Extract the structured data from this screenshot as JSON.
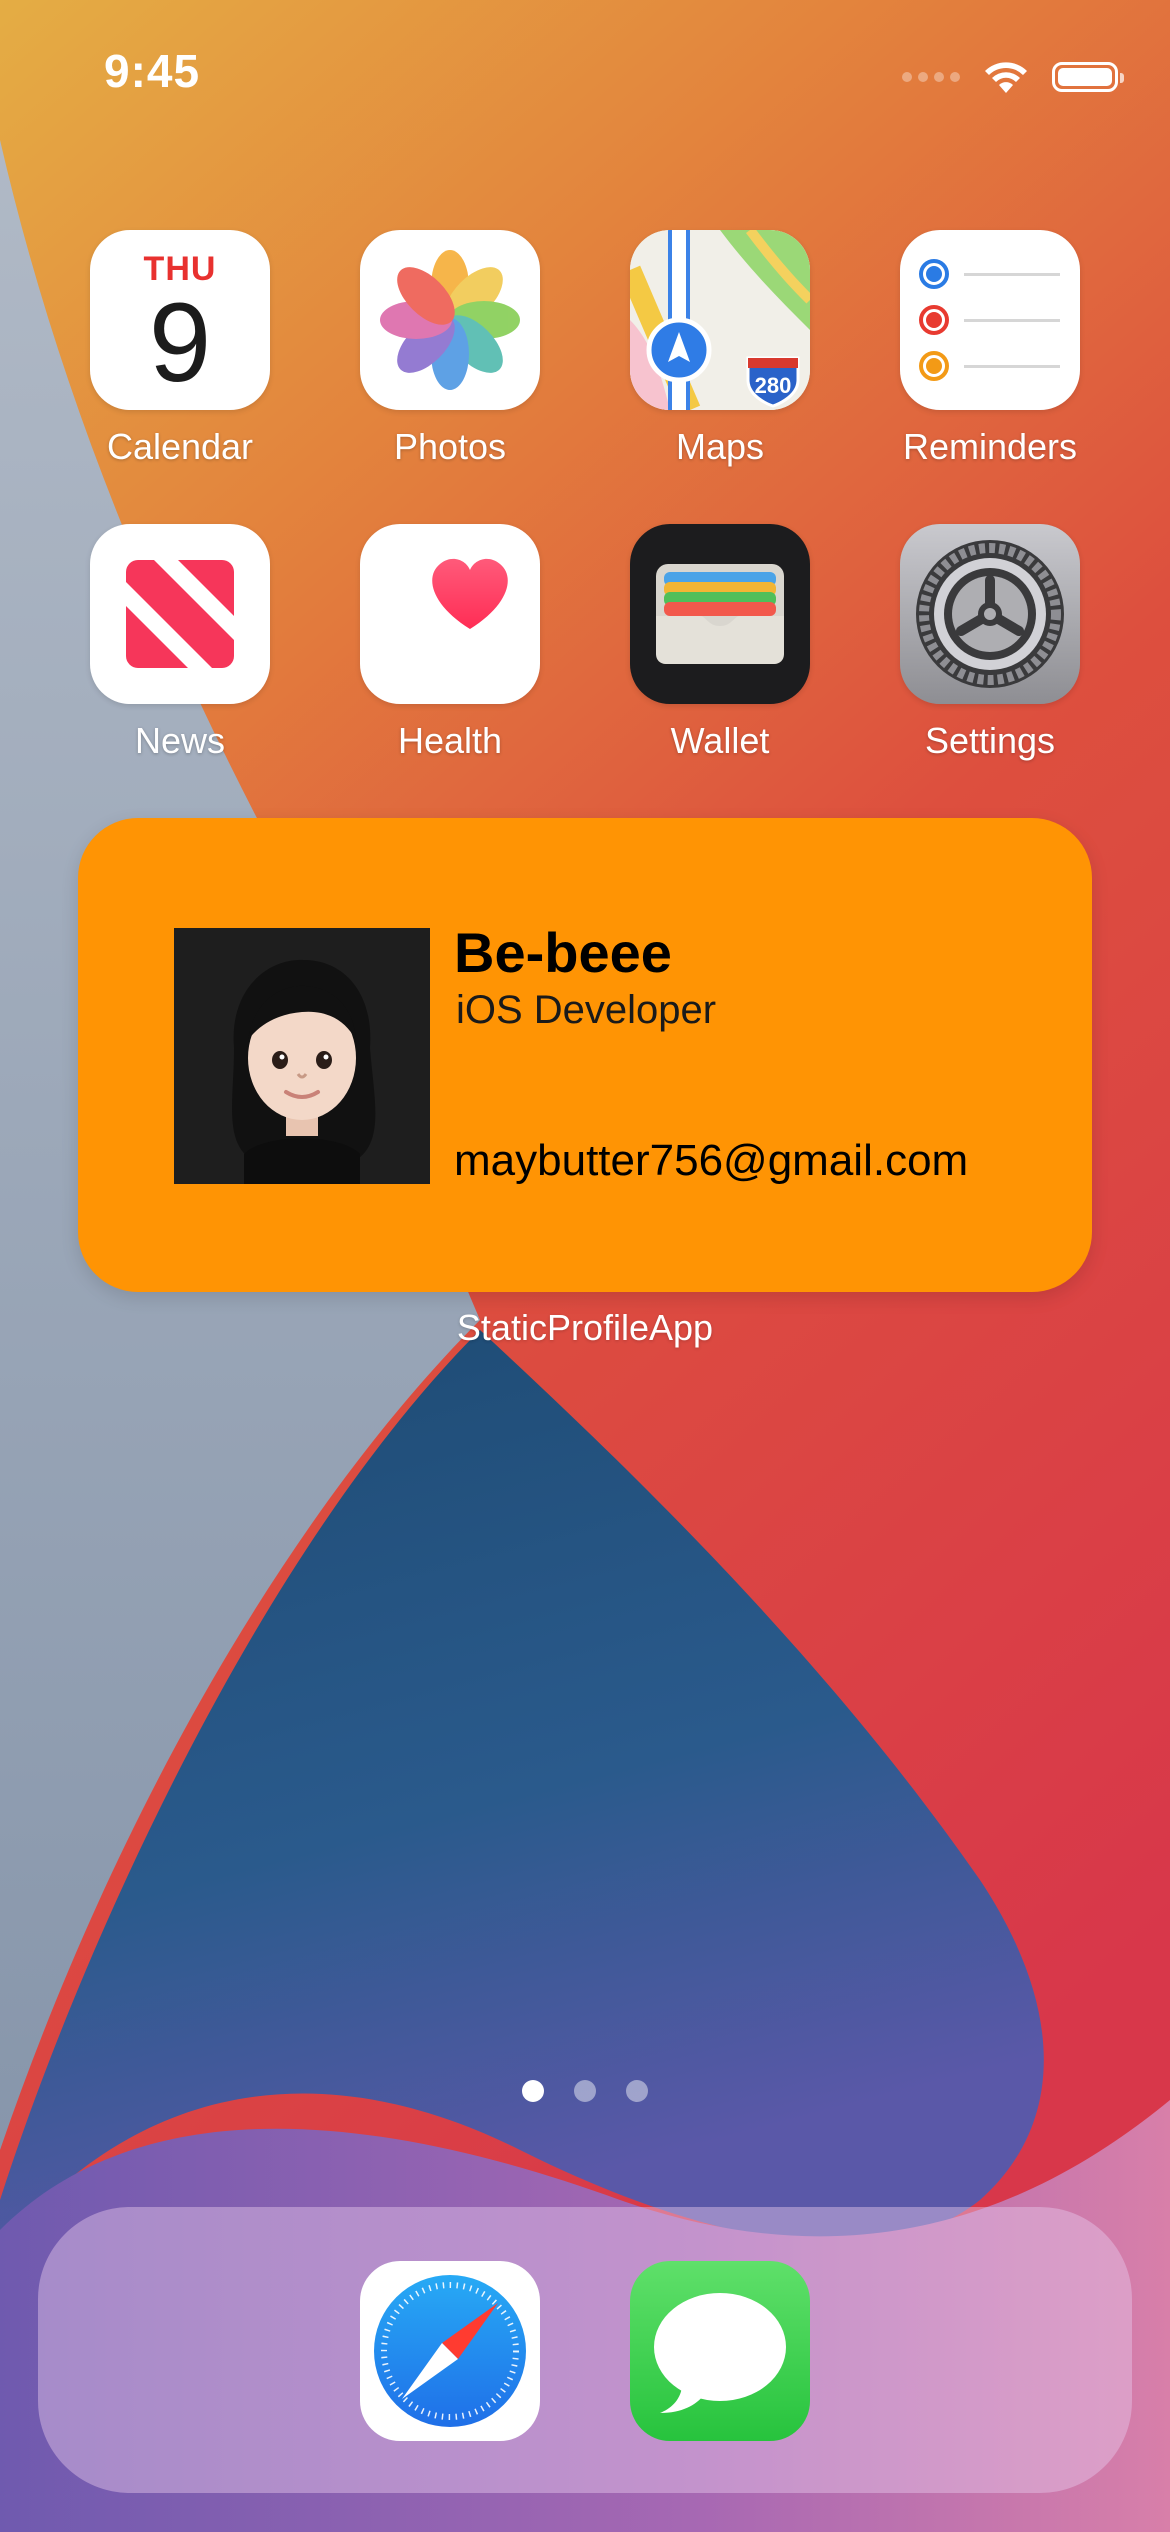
{
  "status_bar": {
    "time": "9:45",
    "icons": [
      "cellular-signal-icon",
      "wifi-icon",
      "battery-icon"
    ]
  },
  "apps": [
    {
      "label": "Calendar",
      "icon": "calendar-icon",
      "day": "THU",
      "date": "9"
    },
    {
      "label": "Photos",
      "icon": "photos-icon"
    },
    {
      "label": "Maps",
      "icon": "maps-icon",
      "badge": "280"
    },
    {
      "label": "Reminders",
      "icon": "reminders-icon"
    },
    {
      "label": "News",
      "icon": "news-icon"
    },
    {
      "label": "Health",
      "icon": "health-icon"
    },
    {
      "label": "Wallet",
      "icon": "wallet-icon"
    },
    {
      "label": "Settings",
      "icon": "settings-icon"
    }
  ],
  "widget": {
    "name": "Be-beee",
    "role": "iOS Developer",
    "email": "maybutter756@gmail.com",
    "app_label": "StaticProfileApp",
    "background": "#ff9404"
  },
  "page_indicator": {
    "pages": 3,
    "current": 1
  },
  "dock": [
    {
      "icon": "safari-icon"
    },
    {
      "icon": "messages-icon"
    }
  ],
  "colors": {
    "calendar_red": "#e8312f",
    "health_pink": "#ff2d55",
    "messages_green": "#34c759",
    "safari_blue": "#1e88f5"
  }
}
